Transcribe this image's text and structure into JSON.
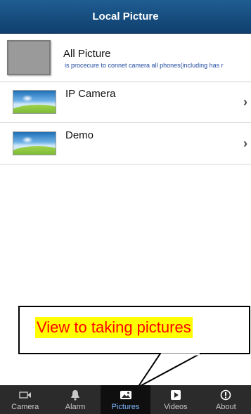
{
  "header": {
    "title": "Local Picture"
  },
  "all_picture": {
    "title": "All Picture",
    "subtitle": "is procecure to connet camera all phones(including has r"
  },
  "list": [
    {
      "label": "IP Camera"
    },
    {
      "label": "Demo"
    }
  ],
  "callout": {
    "text": "View to taking pictures"
  },
  "tabbar": {
    "tabs": [
      {
        "label": "Camera",
        "icon": "camera-icon"
      },
      {
        "label": "Alarm",
        "icon": "bell-icon"
      },
      {
        "label": "Pictures",
        "icon": "picture-icon",
        "active": true
      },
      {
        "label": "Videos",
        "icon": "video-icon"
      },
      {
        "label": "About",
        "icon": "info-icon"
      }
    ]
  },
  "colors": {
    "header": "#0f3f6e",
    "tab_active_text": "#7fb6ff",
    "callout_highlight": "#ffff00",
    "callout_text": "#ff0000"
  }
}
